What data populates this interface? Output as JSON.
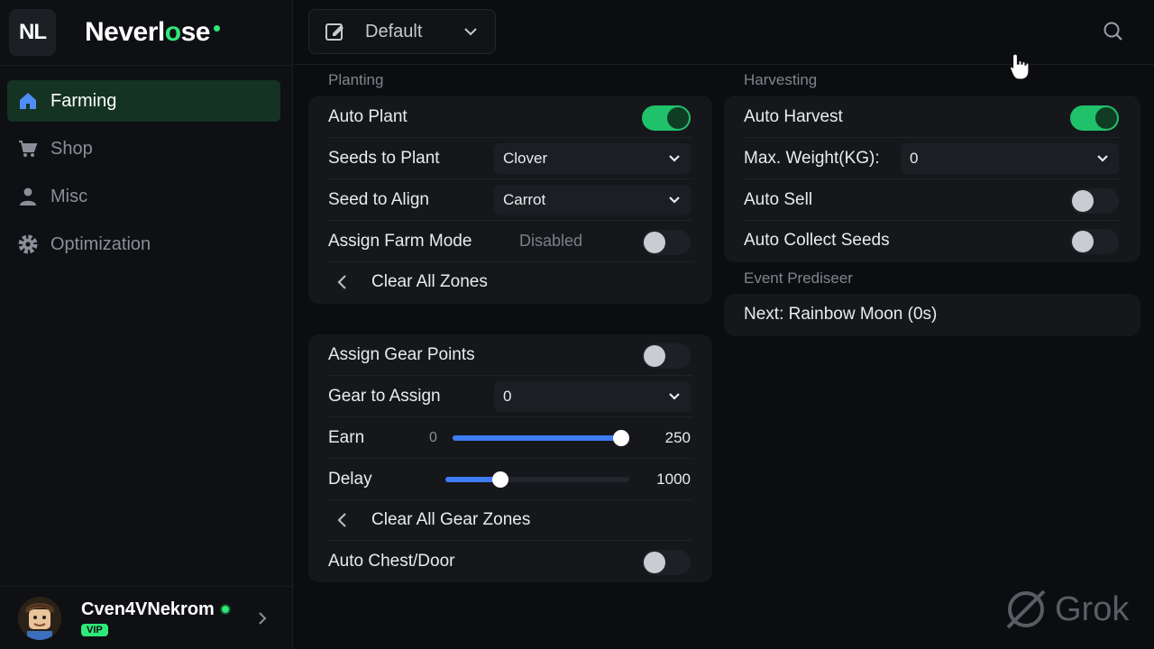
{
  "brand": {
    "logo": "NL",
    "name_main": "Neverl",
    "name_accent": "o",
    "name_tail": "se"
  },
  "nav": {
    "items": [
      {
        "label": "Farming",
        "icon": "home-icon",
        "active": true
      },
      {
        "label": "Shop",
        "icon": "cart-icon",
        "active": false
      },
      {
        "label": "Misc",
        "icon": "person-icon",
        "active": false
      },
      {
        "label": "Optimization",
        "icon": "gear-icon",
        "active": false
      }
    ]
  },
  "user": {
    "name": "Cven4VNekrom",
    "badge": "VIP"
  },
  "toolbar": {
    "config": "Default"
  },
  "planting": {
    "title": "Planting",
    "auto_plant": {
      "label": "Auto Plant",
      "on": true
    },
    "seeds_to_plant": {
      "label": "Seeds to Plant",
      "value": "Clover"
    },
    "seed_to_align": {
      "label": "Seed to Align",
      "value": "Carrot"
    },
    "assign_farm_mode": {
      "label": "Assign Farm Mode",
      "status": "Disabled",
      "on": false
    },
    "clear_zones": {
      "label": "Clear All Zones"
    }
  },
  "gear": {
    "assign_gear_points": {
      "label": "Assign Gear Points",
      "on": false
    },
    "gear_to_assign": {
      "label": "Gear to Assign",
      "value": "0"
    },
    "earn": {
      "label": "Earn",
      "min": "0",
      "value": "250",
      "fraction": 1.0
    },
    "delay": {
      "label": "Delay",
      "value": "1000",
      "fraction": 0.3
    },
    "clear_gear_zones": {
      "label": "Clear All Gear Zones"
    },
    "auto_chest": {
      "label": "Auto Chest/Door",
      "on": false
    }
  },
  "harvesting": {
    "title": "Harvesting",
    "auto_harvest": {
      "label": "Auto Harvest",
      "on": true
    },
    "max_weight": {
      "label": "Max. Weight(KG):",
      "value": "0"
    },
    "auto_sell": {
      "label": "Auto Sell",
      "on": false
    },
    "auto_collect": {
      "label": "Auto Collect Seeds",
      "on": false
    }
  },
  "event": {
    "title": "Event Prediseer",
    "next": "Next: Rainbow Moon (0s)"
  },
  "watermark": "Grok",
  "colors": {
    "accent": "#2ee87a",
    "toggle_on": "#1fc26a",
    "slider": "#3f7cf6"
  }
}
